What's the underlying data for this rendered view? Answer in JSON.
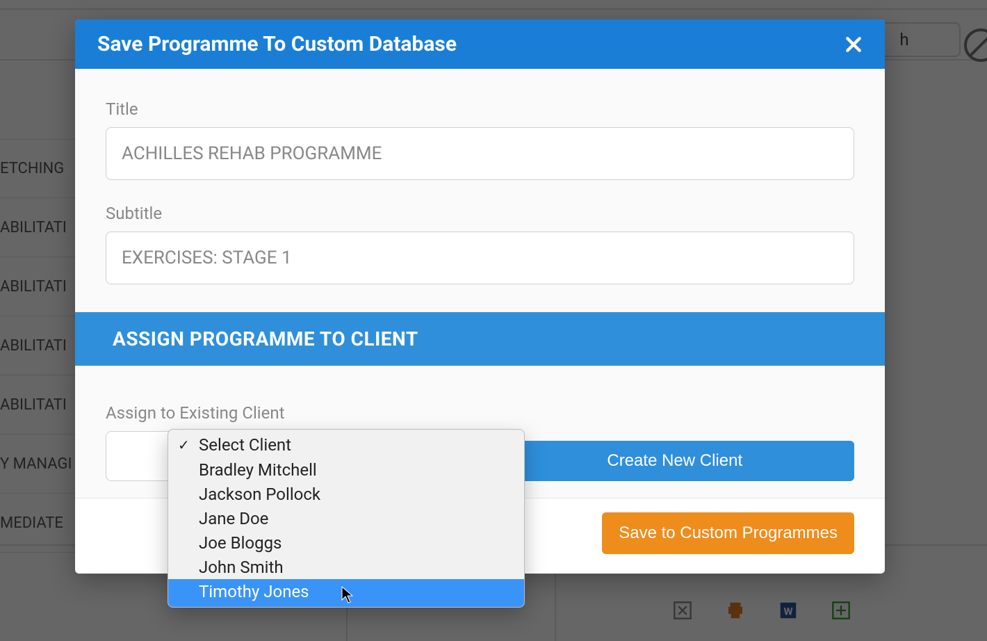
{
  "background": {
    "search_fragment": "h",
    "sidebar_items": [
      "ETCHING",
      "ABILITATI",
      "ABILITATI",
      "ABILITATI",
      "ABILITATI",
      "Y MANAGI",
      "MEDIATE"
    ]
  },
  "modal": {
    "title": "Save Programme To Custom Database",
    "fields": {
      "title_label": "Title",
      "title_value": "ACHILLES REHAB PROGRAMME",
      "subtitle_label": "Subtitle",
      "subtitle_value": "EXERCISES: STAGE 1"
    },
    "section_heading": "ASSIGN PROGRAMME TO CLIENT",
    "assign_label": "Assign to Existing Client",
    "create_button": "Create New Client",
    "save_button": "Save to Custom Programmes"
  },
  "dropdown": {
    "checked_index": 0,
    "highlight_index": 6,
    "options": [
      "Select Client",
      "Bradley Mitchell",
      "Jackson Pollock",
      "Jane Doe",
      "Joe Bloggs",
      "John Smith",
      "Timothy Jones"
    ]
  }
}
